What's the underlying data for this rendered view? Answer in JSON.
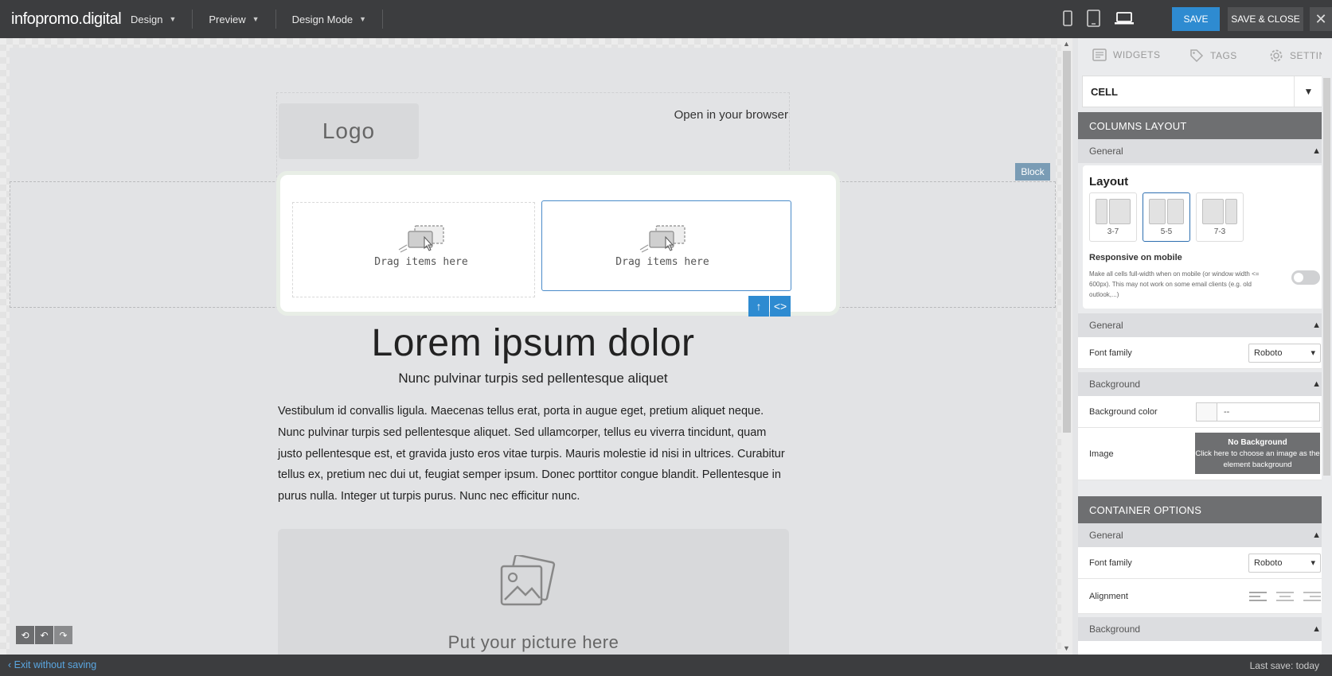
{
  "brand": "infopromo.digital",
  "nav": [
    {
      "label": "Design"
    },
    {
      "label": "Preview"
    },
    {
      "label": "Design Mode"
    }
  ],
  "toolbar": {
    "save_label": "SAVE",
    "save_close_label": "SAVE & CLOSE",
    "close_label": "✕"
  },
  "devices": [
    "phone-icon",
    "tablet-icon",
    "laptop-icon"
  ],
  "canvas": {
    "logo": "Logo",
    "open_browser": "Open in your browser",
    "block_tag": "Block",
    "drag_left": "Drag items here",
    "drag_right": "Drag items here",
    "heading": "Lorem ipsum dolor",
    "subheading": "Nunc pulvinar turpis sed pellentesque aliquet",
    "paragraph": "Vestibulum id convallis ligula. Maecenas tellus erat, porta in augue eget, pretium aliquet neque. Nunc pulvinar turpis sed pellentesque aliquet. Sed ullamcorper, tellus eu viverra tincidunt, quam justo pellentesque est, et gravida justo eros vitae turpis. Mauris molestie id nisi in ultrices. Curabitur tellus ex, pretium nec dui ut, feugiat semper ipsum. Donec porttitor congue blandit. Pellentesque in purus nulla. Integer ut turpis purus. Nunc nec efficitur nunc.",
    "picture_text": "Put your picture here"
  },
  "bottom": {
    "exit": "Exit without saving",
    "last_save": "Last save: today"
  },
  "panel": {
    "tabs": [
      {
        "label": "WIDGETS",
        "icon": "widgets-icon"
      },
      {
        "label": "TAGS",
        "icon": "tag-icon"
      },
      {
        "label": "SETTING",
        "icon": "gear-icon"
      }
    ],
    "cell_select": "CELL",
    "columns_layout": {
      "title": "COLUMNS LAYOUT",
      "general": "General",
      "layout_title": "Layout",
      "options": [
        {
          "label": "3-7",
          "selected": false
        },
        {
          "label": "5-5",
          "selected": true
        },
        {
          "label": "7-3",
          "selected": false
        }
      ],
      "responsive_title": "Responsive on mobile",
      "responsive_desc": "Make all cells full-width when on mobile (or window width <= 600px). This may not work on some email clients (e.g. old outlook,...)",
      "responsive_enabled": false
    },
    "general2": {
      "title": "General",
      "font_family_label": "Font family",
      "font_family_value": "Roboto"
    },
    "background": {
      "title": "Background",
      "color_label": "Background color",
      "color_value": "--",
      "image_label": "Image",
      "nobg_title": "No Background",
      "nobg_desc": "Click here to choose an image as the element background"
    },
    "container": {
      "title": "CONTAINER OPTIONS",
      "general": "General",
      "font_family_label": "Font family",
      "font_family_value": "Roboto",
      "alignment_label": "Alignment",
      "background": "Background"
    }
  },
  "colors": {
    "accent": "#2e8bd1",
    "topbar": "#3c3d3f",
    "section_header": "#6e6f71"
  }
}
